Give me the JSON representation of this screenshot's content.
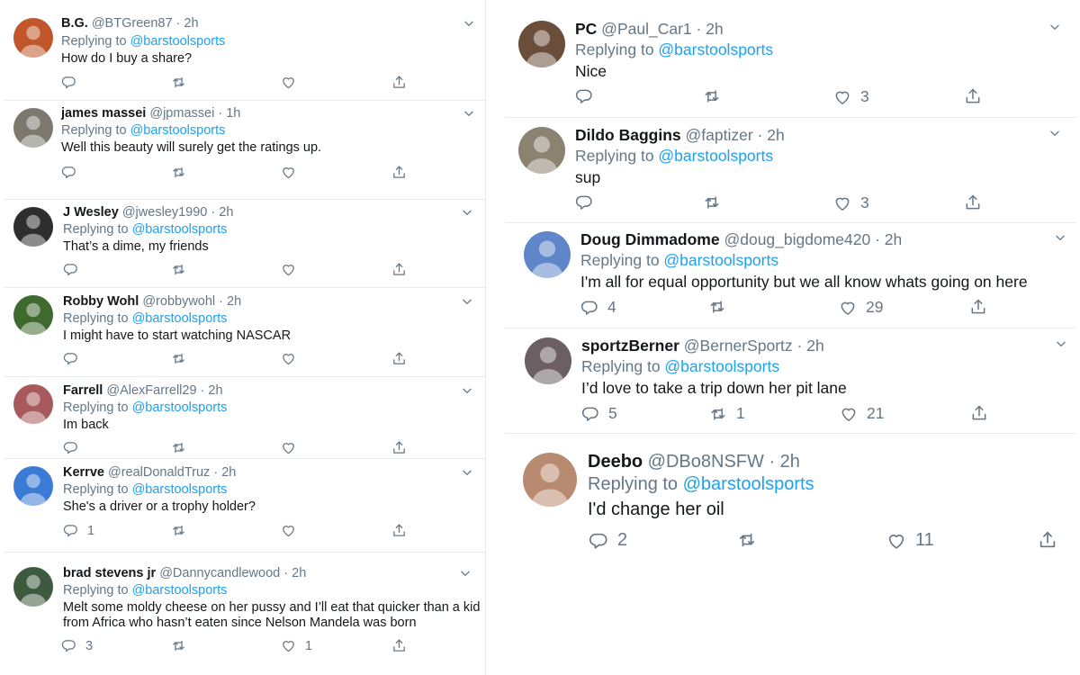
{
  "reply_prefix": "Replying to",
  "left_tweets": [
    {
      "name": "B.G.",
      "handle": "@BTGreen87",
      "time": "2h",
      "mention": "@barstoolsports",
      "text": [
        "How do I buy a share?"
      ],
      "reply_count": "",
      "retweet_count": "",
      "like_count": "",
      "avatar_color": "#c0562a"
    },
    {
      "name": "james massei",
      "handle": "@jpmassei",
      "time": "1h",
      "mention": "@barstoolsports",
      "text": [
        "Well this beauty will surely get the ratings up."
      ],
      "reply_count": "",
      "retweet_count": "",
      "like_count": "",
      "avatar_color": "#7d786e"
    },
    {
      "name": "J Wesley",
      "handle": "@jwesley1990",
      "time": "2h",
      "mention": "@barstoolsports",
      "text": [
        "That’s a dime, my friends"
      ],
      "reply_count": "",
      "retweet_count": "",
      "like_count": "",
      "avatar_color": "#2e2e2e"
    },
    {
      "name": "Robby Wohl",
      "handle": "@robbywohl",
      "time": "2h",
      "mention": "@barstoolsports",
      "text": [
        "I might have to start watching NASCAR"
      ],
      "reply_count": "",
      "retweet_count": "",
      "like_count": "",
      "avatar_color": "#3f6a2e"
    },
    {
      "name": "Farrell",
      "handle": "@AlexFarrell29",
      "time": "2h",
      "mention": "@barstoolsports",
      "text": [
        "Im back"
      ],
      "reply_count": "",
      "retweet_count": "",
      "like_count": "",
      "avatar_color": "#a8595b"
    },
    {
      "name": "Kerrve",
      "handle": "@realDonaldTruz",
      "time": "2h",
      "mention": "@barstoolsports",
      "text": [
        "She's a driver or a trophy holder?"
      ],
      "reply_count": "1",
      "retweet_count": "",
      "like_count": "",
      "avatar_color": "#3a7bd5"
    },
    {
      "name": "brad stevens jr",
      "handle": "@Dannycandlewood",
      "time": "2h",
      "mention": "@barstoolsports",
      "text": [
        "Melt some moldy cheese on her pussy and I’ll eat that quicker than a kid",
        "from Africa who hasn’t eaten since Nelson Mandela was born"
      ],
      "reply_count": "3",
      "retweet_count": "",
      "like_count": "1",
      "avatar_color": "#3d5a3e"
    }
  ],
  "right_tweets": [
    {
      "name": "PC",
      "handle": "@Paul_Car1",
      "time": "2h",
      "mention": "@barstoolsports",
      "text": [
        "Nice"
      ],
      "reply_count": "",
      "retweet_count": "",
      "like_count": "3",
      "avatar_color": "#6b4e3a"
    },
    {
      "name": "Dildo Baggins",
      "handle": "@faptizer",
      "time": "2h",
      "mention": "@barstoolsports",
      "text": [
        "sup"
      ],
      "reply_count": "",
      "retweet_count": "",
      "like_count": "3",
      "avatar_color": "#8c8270"
    },
    {
      "name": "Doug Dimmadome",
      "handle": "@doug_bigdome420",
      "time": "2h",
      "mention": "@barstoolsports",
      "text": [
        "I'm all for equal opportunity but we all know whats going on here"
      ],
      "reply_count": "4",
      "retweet_count": "",
      "like_count": "29",
      "avatar_color": "#5f86c9"
    },
    {
      "name": "sportzBerner",
      "handle": "@BernerSportz",
      "time": "2h",
      "mention": "@barstoolsports",
      "text": [
        "I’d love to take a trip down her pit lane"
      ],
      "reply_count": "5",
      "retweet_count": "1",
      "like_count": "21",
      "avatar_color": "#6c5f63"
    },
    {
      "name": "Deebo",
      "handle": "@DBo8NSFW",
      "time": "2h",
      "mention": "@barstoolsports",
      "text": [
        "I'd change her oil"
      ],
      "reply_count": "2",
      "retweet_count": "",
      "like_count": "11",
      "avatar_color": "#b88a70"
    }
  ],
  "colors": {
    "link": "#1da1f2",
    "muted": "#657786",
    "text": "#14171a",
    "divider": "#e6ecf0"
  },
  "icons": [
    "reply-icon",
    "retweet-icon",
    "like-icon",
    "share-icon",
    "chevron-down-icon"
  ]
}
